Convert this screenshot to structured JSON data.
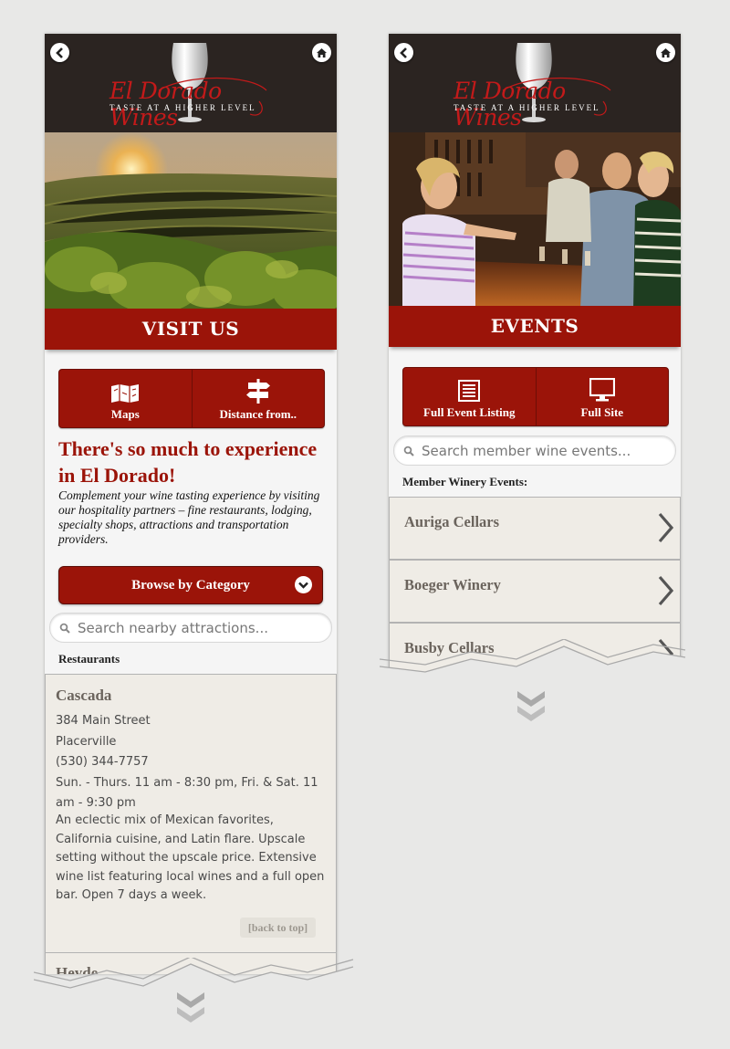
{
  "left_screen": {
    "header": {
      "logo_text": "El Dorado Wines",
      "tagline": "TASTE AT A HIGHER LEVEL",
      "back_icon": "back-arrow-icon",
      "home_icon": "home-icon"
    },
    "banner": "VISIT US",
    "buttons": [
      {
        "label": "Maps",
        "icon": "map-icon"
      },
      {
        "label": "Distance from..",
        "icon": "signpost-icon"
      }
    ],
    "headline": "There's so much to experience in El Dorado!",
    "intro": "Complement your wine tasting experience by visiting our hospitality partners – fine restaurants, lodging, specialty shops, attractions and transportation providers.",
    "browse_label": "Browse by Category",
    "search_placeholder": "Search nearby attractions...",
    "section_label": "Restaurants",
    "listing": {
      "name": "Cascada",
      "address": "384 Main Street",
      "city": "Placerville",
      "phone": "(530) 344-7757",
      "hours": "Sun. - Thurs. 11 am - 8:30 pm, Fri. & Sat. 11 am - 9:30 pm",
      "description": "An eclectic mix of Mexican favorites, California cuisine, and Latin flare. Upscale setting without the upscale price. Extensive wine list featuring local wines and a full open bar. Open 7 days a week.",
      "back_to_top": "[back to top]"
    },
    "next_listing_partial": "Heyde"
  },
  "right_screen": {
    "header": {
      "logo_text": "El Dorado Wines",
      "tagline": "TASTE AT A HIGHER LEVEL",
      "back_icon": "back-arrow-icon",
      "home_icon": "home-icon"
    },
    "banner": "EVENTS",
    "buttons": [
      {
        "label": "Full Event Listing",
        "icon": "list-icon"
      },
      {
        "label": "Full Site",
        "icon": "monitor-icon"
      }
    ],
    "search_placeholder": "Search member wine events...",
    "section_label": "Member Winery Events:",
    "wineries": [
      "Auriga Cellars",
      "Boeger Winery",
      "Busby Cellars"
    ]
  },
  "colors": {
    "brand_red": "#9b1409",
    "header_dark": "#2b2421",
    "card_bg": "#efece6"
  }
}
